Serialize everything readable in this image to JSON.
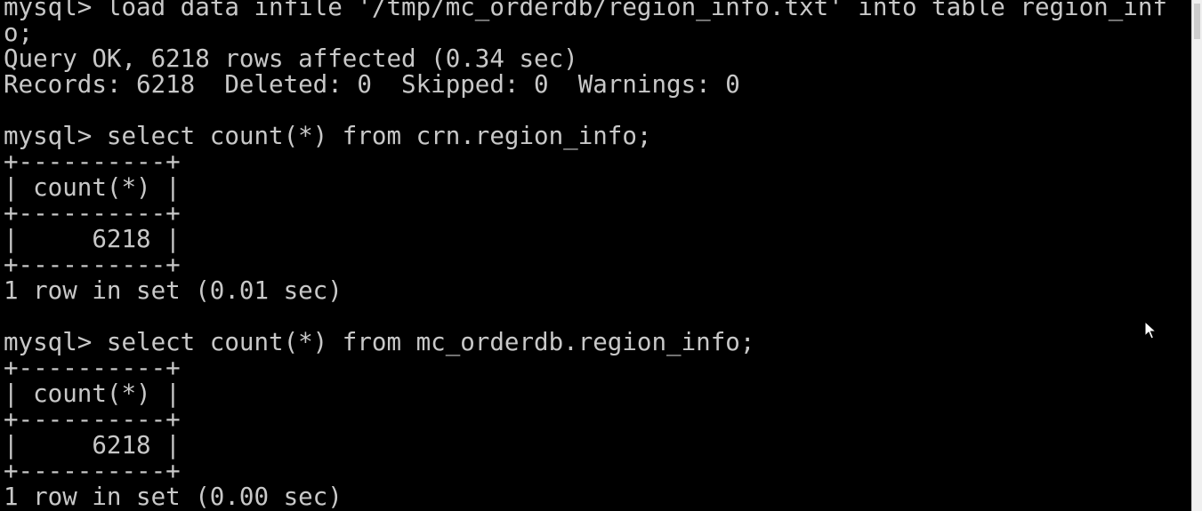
{
  "terminal": {
    "lines": [
      "mysql> load data infile '/tmp/mc_orderdb/region_info.txt' into table region_inf",
      "o;",
      "Query OK, 6218 rows affected (0.34 sec)",
      "Records: 6218  Deleted: 0  Skipped: 0  Warnings: 0",
      "",
      "mysql> select count(*) from crn.region_info;",
      "+----------+",
      "| count(*) |",
      "+----------+",
      "|     6218 |",
      "+----------+",
      "1 row in set (0.01 sec)",
      "",
      "mysql> select count(*) from mc_orderdb.region_info;",
      "+----------+",
      "| count(*) |",
      "+----------+",
      "|     6218 |",
      "+----------+",
      "1 row in set (0.00 sec)"
    ]
  },
  "colors": {
    "background": "#000000",
    "text": "#c8c8c8",
    "scrollbar": "#f0f0f0"
  },
  "icons": {
    "cursor": "mouse-pointer-icon"
  }
}
